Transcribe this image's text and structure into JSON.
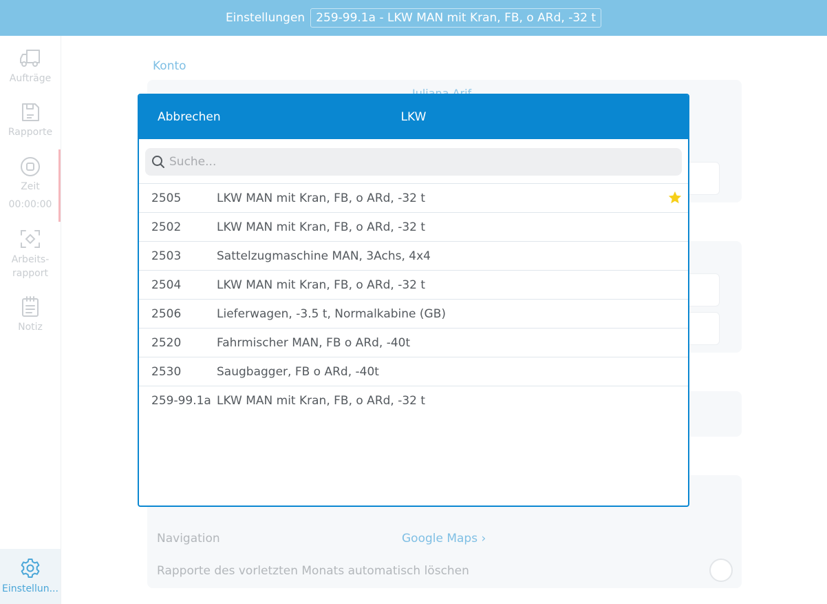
{
  "header": {
    "title": "Einstellungen",
    "vehicle": "259-99.1a - LKW MAN mit Kran, FB, o ARd, -32 t"
  },
  "sidebar": {
    "items": [
      {
        "label": "Aufträge",
        "icon": "truck-icon"
      },
      {
        "label": "Rapporte",
        "icon": "save-icon"
      },
      {
        "label": "Zeit",
        "sublabel": "00:00:00",
        "icon": "stop-icon"
      },
      {
        "label": "Arbeits-\nrapport",
        "icon": "scan-icon"
      },
      {
        "label": "Notiz",
        "icon": "notepad-icon"
      },
      {
        "label": "Einstellun...",
        "icon": "gear-icon",
        "active": true
      }
    ]
  },
  "settings": {
    "section_konto": "Konto",
    "user_name": "Juliana Arif",
    "navigation_label": "Navigation",
    "navigation_value": "Google Maps",
    "auto_delete_label": "Rapporte des vorletzten Monats automatisch löschen"
  },
  "modal": {
    "cancel_label": "Abbrechen",
    "title": "LKW",
    "search_placeholder": "Suche...",
    "vehicles": [
      {
        "id": "2505",
        "name": "LKW MAN mit Kran, FB, o ARd, -32 t",
        "favorite": true
      },
      {
        "id": "2502",
        "name": "LKW MAN mit Kran, FB, o ARd, -32 t",
        "favorite": false
      },
      {
        "id": "2503",
        "name": "Sattelzugmaschine MAN, 3Achs, 4x4",
        "favorite": false
      },
      {
        "id": "2504",
        "name": "LKW MAN mit Kran, FB, o ARd, -32 t",
        "favorite": false
      },
      {
        "id": "2506",
        "name": "Lieferwagen, -3.5 t, Normalkabine (GB)",
        "favorite": false
      },
      {
        "id": "2520",
        "name": "Fahrmischer MAN, FB o ARd, -40t",
        "favorite": false
      },
      {
        "id": "2530",
        "name": "Saugbagger, FB o ARd, -40t",
        "favorite": false
      },
      {
        "id": "259-99.1a",
        "name": "LKW MAN mit Kran, FB, o ARd, -32 t",
        "favorite": false
      }
    ]
  },
  "colors": {
    "topbar": "#7fc3e6",
    "modal_accent": "#0a87d1",
    "star": "#f6cf1a",
    "active_nav": "#4aa6d8"
  }
}
